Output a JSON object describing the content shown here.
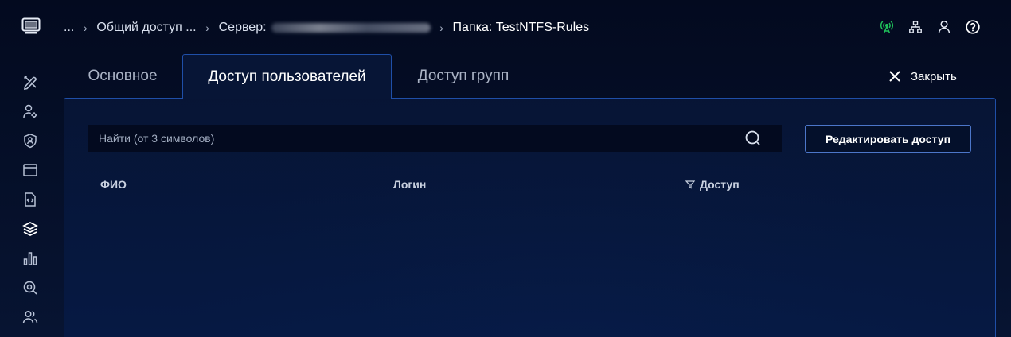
{
  "breadcrumb": {
    "items": [
      {
        "label": "..."
      },
      {
        "label": "Общий доступ ..."
      },
      {
        "label": "Сервер:"
      },
      {
        "label": "Папка: TestNTFS-Rules"
      }
    ]
  },
  "header_icons": [
    "antenna-icon",
    "network-icon",
    "user-icon",
    "help-icon"
  ],
  "sidebar": {
    "items": [
      "tools-icon",
      "user-settings-icon",
      "shield-icon",
      "window-icon",
      "code-file-icon",
      "layers-icon",
      "bar-chart-icon",
      "search-zoom-icon",
      "users-icon"
    ],
    "active": "layers-icon"
  },
  "tabs": [
    {
      "label": "Основное",
      "active": false
    },
    {
      "label": "Доступ пользователей",
      "active": true
    },
    {
      "label": "Доступ групп",
      "active": false
    }
  ],
  "close_label": "Закрыть",
  "search": {
    "placeholder": "Найти (от 3 символов)",
    "value": ""
  },
  "edit_button_label": "Редактировать доступ",
  "table": {
    "columns": [
      {
        "label": "ФИО",
        "filter": false
      },
      {
        "label": "Логин",
        "filter": false
      },
      {
        "label": "Доступ",
        "filter": true
      }
    ],
    "rows": []
  },
  "colors": {
    "background": "#050d24",
    "accent_border": "#1f4fa8",
    "status_green": "#1fc15a"
  }
}
